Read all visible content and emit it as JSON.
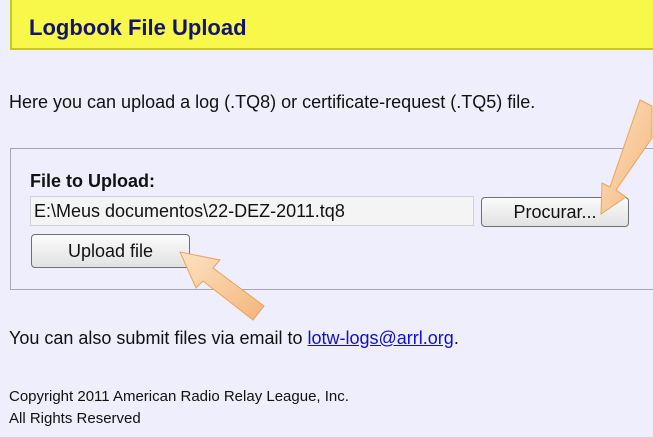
{
  "header": {
    "title": "Logbook File Upload"
  },
  "intro_text": "Here you can upload a log (.TQ8) or certificate-request (.TQ5) file.",
  "form": {
    "label": "File to Upload:",
    "file_value": "E:\\Meus documentos\\22-DEZ-2011.tq8",
    "browse_label": "Procurar...",
    "upload_label": "Upload file"
  },
  "email": {
    "text": "You can also submit files via email to ",
    "link": "lotw-logs@arrl.org",
    "suffix": "."
  },
  "footer": {
    "copyright": "Copyright 2011 American Radio Relay League, Inc.",
    "rights": "All Rights Reserved"
  },
  "colors": {
    "header_bg": "#f8f84a",
    "title": "#14146e",
    "page_bg": "#eeeefc",
    "link": "#1010cc",
    "arrow_fill": "#f9c78e"
  },
  "annotations": [
    "arrow-to-browse-button",
    "arrow-to-upload-button"
  ]
}
